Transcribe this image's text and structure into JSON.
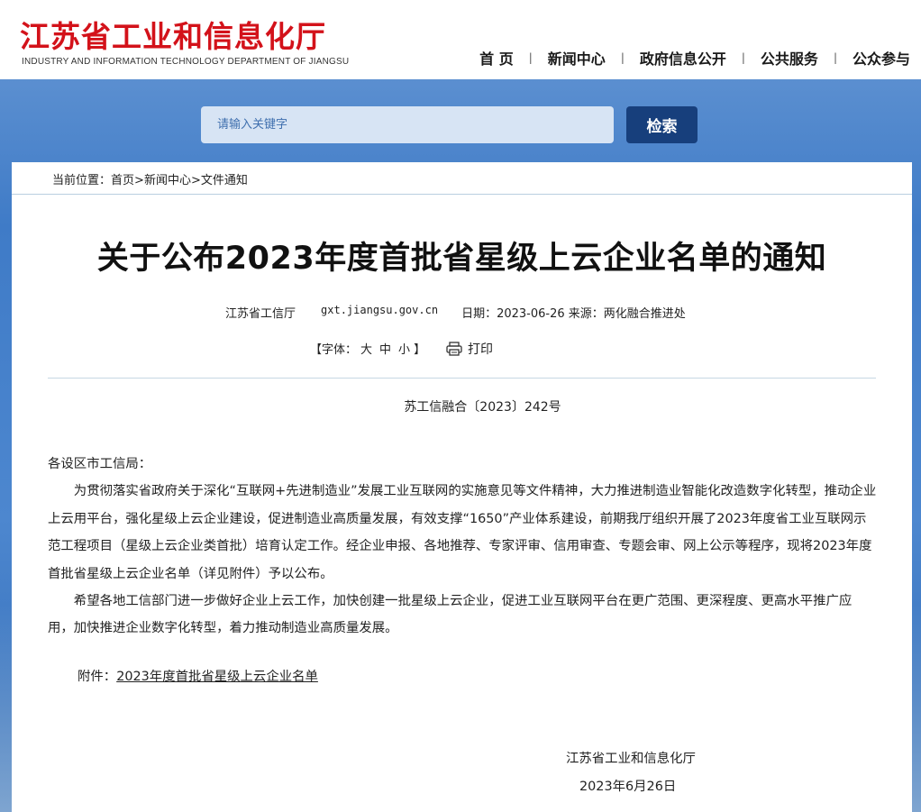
{
  "header": {
    "logo_cn": "江苏省工业和信息化厅",
    "logo_en": "INDUSTRY AND INFORMATION TECHNOLOGY DEPARTMENT OF JIANGSU",
    "nav": [
      "首 页",
      "新闻中心",
      "政府信息公开",
      "公共服务",
      "公众参与"
    ],
    "nav_separator": "|"
  },
  "search": {
    "placeholder": "请输入关键字",
    "button_label": "检索"
  },
  "breadcrumb": {
    "prefix": "当前位置：",
    "items": [
      "首页",
      "新闻中心",
      "文件通知"
    ],
    "separator": ">"
  },
  "article": {
    "title": "关于公布2023年度首批省星级上云企业名单的通知",
    "meta": {
      "publisher": "江苏省工信厅",
      "site": "gxt.jiangsu.gov.cn",
      "date_source": "日期：2023-06-26 来源：两化融合推进处"
    },
    "font_size": {
      "open": "【字体：",
      "large": "大",
      "medium": "中",
      "small": "小",
      "close": "】"
    },
    "print_label": "打印",
    "doc_number": "苏工信融合〔2023〕242号",
    "salutation": "各设区市工信局：",
    "paragraphs": [
      "为贯彻落实省政府关于深化“互联网+先进制造业”发展工业互联网的实施意见等文件精神，大力推进制造业智能化改造数字化转型，推动企业上云用平台，强化星级上云企业建设，促进制造业高质量发展，有效支撑“1650”产业体系建设，前期我厅组织开展了2023年度省工业互联网示范工程项目（星级上云企业类首批）培育认定工作。经企业申报、各地推荐、专家评审、信用审查、专题会审、网上公示等程序，现将2023年度首批省星级上云企业名单（详见附件）予以公布。",
      "希望各地工信部门进一步做好企业上云工作，加快创建一批星级上云企业，促进工业互联网平台在更广范围、更深程度、更高水平推广应用，加快推进企业数字化转型，着力推动制造业高质量发展。"
    ],
    "attachment_label": "附件：",
    "attachment_link": "2023年度首批省星级上云企业名单",
    "signature_org": "江苏省工业和信息化厅",
    "signature_date": "2023年6月26日"
  },
  "colors": {
    "logo_red": "#d3121a",
    "banner_blue": "#3f7bc7",
    "search_button": "#173f7c"
  }
}
